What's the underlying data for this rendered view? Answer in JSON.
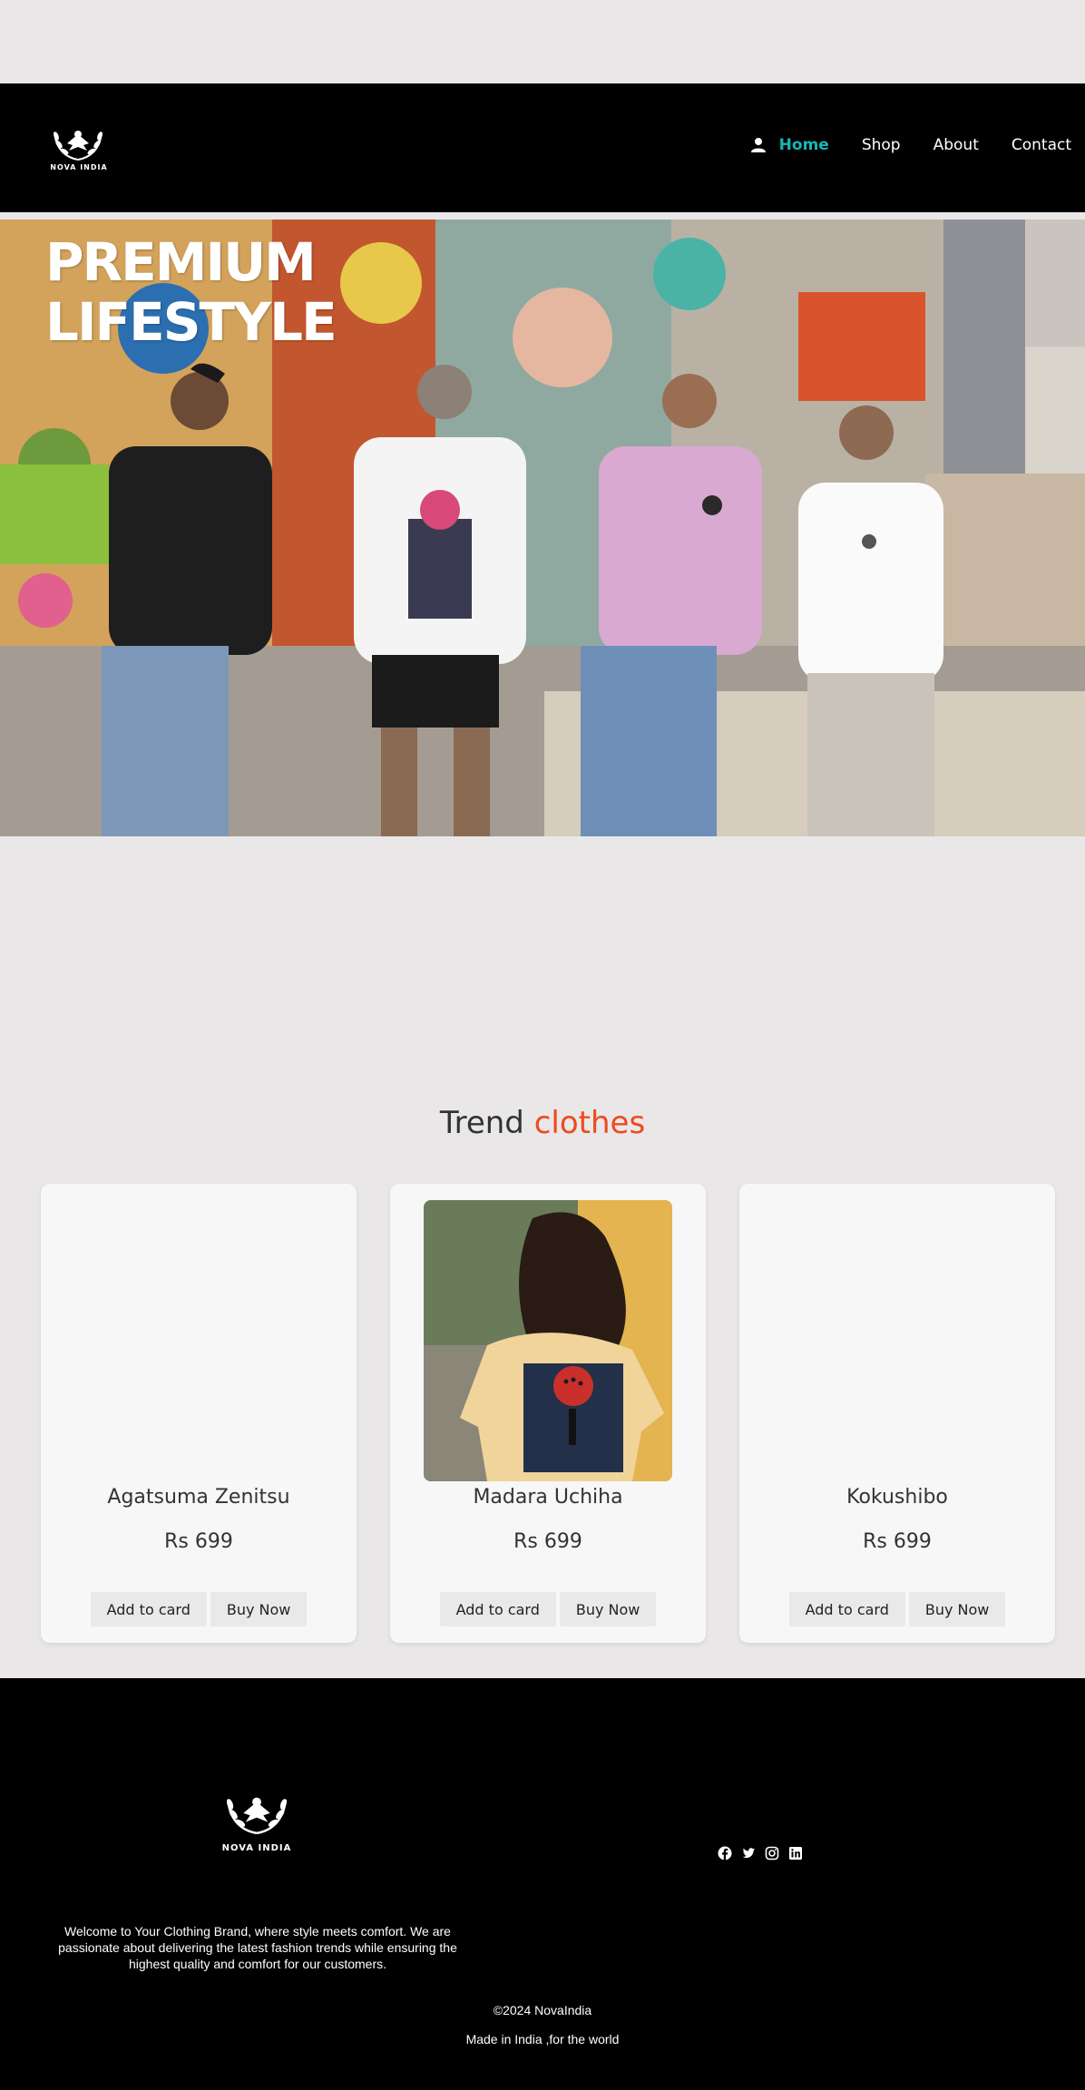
{
  "brand": {
    "name": "NOVA INDIA"
  },
  "nav": {
    "items": [
      {
        "label": "Home",
        "active": true
      },
      {
        "label": "Shop",
        "active": false
      },
      {
        "label": "About",
        "active": false
      },
      {
        "label": "Contact",
        "active": false
      }
    ],
    "active_color": "#16b5b5"
  },
  "hero": {
    "title_line1": "PREMIUM",
    "title_line2": "LIFESTYLE"
  },
  "section": {
    "title_plain": "Trend",
    "title_accent": "clothes",
    "accent_color": "#ee4a1e"
  },
  "products": [
    {
      "name": "Agatsuma Zenitsu",
      "price": "Rs 699",
      "add_label": "Add to card",
      "buy_label": "Buy Now"
    },
    {
      "name": "Madara Uchiha",
      "price": "Rs 699",
      "add_label": "Add to card",
      "buy_label": "Buy Now"
    },
    {
      "name": "Kokushibo",
      "price": "Rs 699",
      "add_label": "Add to card",
      "buy_label": "Buy Now"
    }
  ],
  "footer": {
    "brand": "NOVA INDIA",
    "description": "Welcome to Your Clothing Brand, where style meets comfort. We are passionate about delivering the latest fashion trends while ensuring the highest quality and comfort for our customers.",
    "copyright": "©2024 NovaIndia",
    "made_in": "Made in India ,for the world",
    "socials": [
      "facebook-icon",
      "twitter-icon",
      "instagram-icon",
      "linkedin-icon"
    ]
  }
}
